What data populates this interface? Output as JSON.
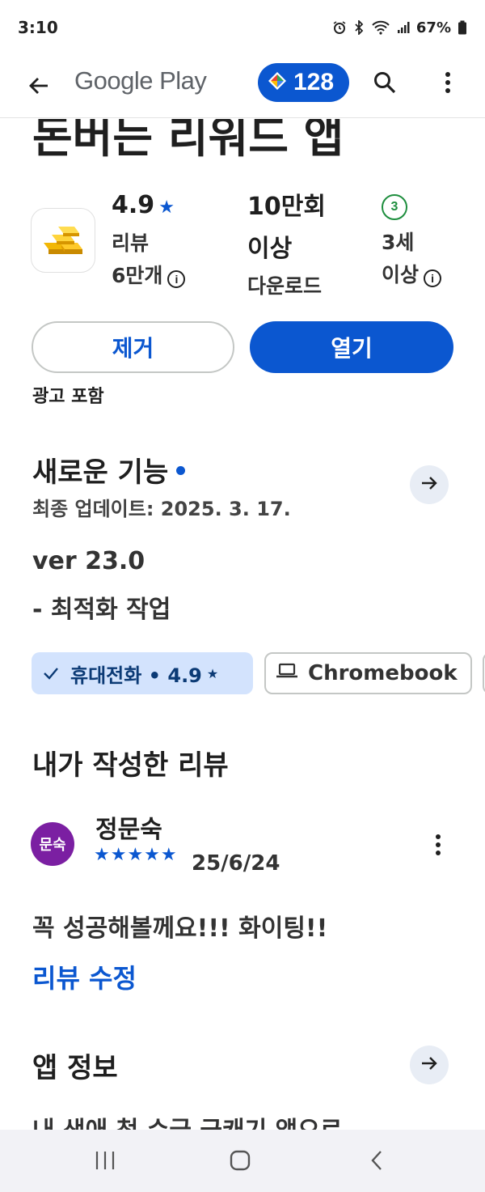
{
  "status_bar": {
    "time": "3:10",
    "battery": "67%"
  },
  "app_bar": {
    "brand": "Google Play",
    "points": "128"
  },
  "app": {
    "title": "돈버는 리워드 앱",
    "rating": "4.9",
    "reviews_label": "리뷰",
    "reviews_count": "6만개",
    "downloads_line1": "10만회",
    "downloads_line2": "이상",
    "downloads_label": "다운로드",
    "age_badge": "3",
    "age_line1": "3세",
    "age_line2": "이상"
  },
  "actions": {
    "uninstall": "제거",
    "open": "열기",
    "ads_note": "광고 포함"
  },
  "whats_new": {
    "title": "새로운 기능",
    "updated": "최종 업데이트: 2025. 3. 17.",
    "lines": [
      "ver 23.0",
      "- 최적화 작업"
    ]
  },
  "devices": {
    "phone": "휴대전화 • 4.9",
    "chromebook": "Chromebook"
  },
  "my_review": {
    "title": "내가 작성한 리뷰",
    "avatar_text": "문숙",
    "reviewer": "정문숙",
    "stars": "★★★★★",
    "date": "25/6/24",
    "text": "꼭 성공해볼께요!!! 화이팅!!",
    "edit": "리뷰 수정"
  },
  "about": {
    "title": "앱 정보",
    "text": "내 생애 첫 수급 금캐기 앱으로"
  },
  "colors": {
    "accent": "#0b57d0",
    "chip_bg": "#d3e3fd",
    "avatar": "#7b1fa2",
    "age_green": "#1e8e3e"
  },
  "icons": [
    "back-arrow-icon",
    "play-points-icon",
    "search-icon",
    "more-vert-icon",
    "gold-bars-icon",
    "info-icon",
    "arrow-right-icon",
    "check-icon",
    "laptop-icon",
    "recents-icon",
    "home-icon",
    "nav-back-icon"
  ]
}
